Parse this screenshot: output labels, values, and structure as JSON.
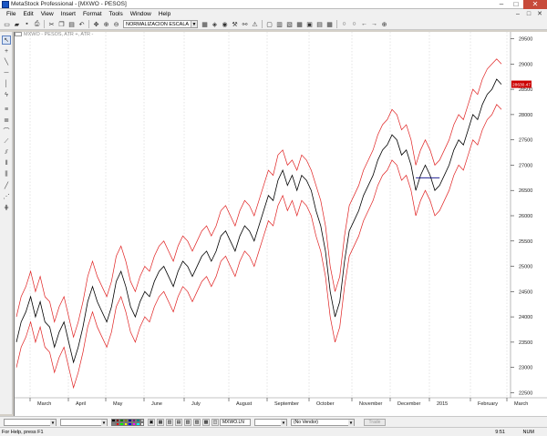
{
  "window": {
    "title": "MetaStock Professional - [MXWO - PESOS]",
    "controls": [
      "–",
      "□",
      "✕"
    ]
  },
  "menu": [
    "File",
    "Edit",
    "View",
    "Insert",
    "Format",
    "Tools",
    "Window",
    "Help"
  ],
  "toolbar": {
    "scale_combo": "NORMALIZACION ESCALA"
  },
  "chart": {
    "header": "MXWO - PESOS, ATR +, ATR -",
    "price_tag": "28630.47",
    "y_ticks": [
      22500,
      23000,
      23500,
      24000,
      24500,
      25000,
      25500,
      26000,
      26500,
      27000,
      27500,
      28000,
      28500,
      29000,
      29500
    ],
    "x_labels": [
      "March",
      "April",
      "May",
      "June",
      "July",
      "August",
      "September",
      "October",
      "November",
      "December",
      "2015",
      "February",
      "March"
    ],
    "colors": {
      "price": "#000000",
      "bands": "#e02020",
      "grid": "#c8c8c8",
      "hline": "#000080",
      "tag_bg": "#cc0000"
    }
  },
  "chart_data": {
    "type": "line",
    "title": "MXWO - PESOS, ATR +, ATR -",
    "xlabel": "",
    "ylabel": "",
    "ylim": [
      22400,
      29600
    ],
    "x_labels": [
      "March",
      "April",
      "May",
      "June",
      "July",
      "August",
      "September",
      "October",
      "November",
      "December",
      "2015",
      "February",
      "March"
    ],
    "series": [
      {
        "name": "MXWO - PESOS",
        "values": [
          23500,
          23900,
          24100,
          24400,
          24000,
          24300,
          23900,
          23800,
          23400,
          23700,
          23900,
          23500,
          23100,
          23400,
          23800,
          24300,
          24600,
          24300,
          24100,
          23900,
          24200,
          24700,
          24900,
          24600,
          24200,
          24000,
          24300,
          24500,
          24400,
          24700,
          24900,
          25000,
          24800,
          24600,
          24900,
          25100,
          25000,
          24800,
          25000,
          25200,
          25300,
          25100,
          25300,
          25600,
          25700,
          25500,
          25300,
          25600,
          25800,
          25700,
          25500,
          25800,
          26100,
          26400,
          26300,
          26700,
          26900,
          26600,
          26800,
          26500,
          26800,
          26700,
          26500,
          26100,
          25800,
          25300,
          24500,
          24000,
          24300,
          25100,
          25700,
          25900,
          26100,
          26400,
          26600,
          26800,
          27100,
          27300,
          27400,
          27600,
          27500,
          27200,
          27300,
          27000,
          26500,
          26800,
          27000,
          26800,
          26500,
          26600,
          26800,
          27000,
          27300,
          27500,
          27400,
          27700,
          28000,
          27900,
          28200,
          28400,
          28500,
          28700,
          28600
        ]
      },
      {
        "name": "ATR +",
        "values": [
          24000,
          24400,
          24600,
          24900,
          24500,
          24800,
          24400,
          24300,
          23900,
          24200,
          24400,
          24000,
          23600,
          23900,
          24300,
          24800,
          25100,
          24800,
          24600,
          24400,
          24700,
          25200,
          25400,
          25100,
          24700,
          24500,
          24800,
          25000,
          24900,
          25200,
          25400,
          25500,
          25300,
          25100,
          25400,
          25600,
          25500,
          25300,
          25500,
          25700,
          25800,
          25600,
          25800,
          26100,
          26200,
          26000,
          25800,
          26100,
          26300,
          26200,
          26000,
          26300,
          26600,
          26900,
          26800,
          27200,
          27300,
          27000,
          27100,
          26900,
          27200,
          27100,
          26900,
          26600,
          26300,
          25800,
          25000,
          24500,
          24800,
          25600,
          26200,
          26400,
          26600,
          26900,
          27100,
          27300,
          27600,
          27800,
          27900,
          28100,
          28000,
          27700,
          27800,
          27500,
          27000,
          27300,
          27500,
          27300,
          27000,
          27100,
          27300,
          27500,
          27800,
          28000,
          27900,
          28200,
          28500,
          28400,
          28700,
          28900,
          29000,
          29100,
          29000
        ]
      },
      {
        "name": "ATR -",
        "values": [
          23000,
          23400,
          23600,
          23900,
          23500,
          23800,
          23400,
          23300,
          22900,
          23200,
          23400,
          23000,
          22600,
          22900,
          23300,
          23800,
          24100,
          23800,
          23600,
          23400,
          23700,
          24200,
          24400,
          24100,
          23700,
          23500,
          23800,
          24000,
          23900,
          24200,
          24400,
          24500,
          24300,
          24100,
          24400,
          24600,
          24500,
          24300,
          24500,
          24700,
          24800,
          24600,
          24800,
          25100,
          25200,
          25000,
          24800,
          25100,
          25300,
          25200,
          25000,
          25300,
          25600,
          25900,
          25800,
          26200,
          26400,
          26100,
          26300,
          26000,
          26300,
          26200,
          26000,
          25600,
          25300,
          24800,
          24000,
          23500,
          23800,
          24600,
          25200,
          25400,
          25600,
          25900,
          26100,
          26300,
          26600,
          26800,
          26900,
          27100,
          27000,
          26700,
          26800,
          26500,
          26000,
          26300,
          26500,
          26300,
          26000,
          26100,
          26300,
          26500,
          26800,
          27000,
          26900,
          27200,
          27500,
          27400,
          27700,
          27900,
          28000,
          28200,
          28100
        ]
      }
    ],
    "hline_value": 26750
  },
  "status": {
    "vendor": "(No Vendor)",
    "symbol": "MXWO.LN",
    "trade": "Trade",
    "help": "For Help, press F1",
    "time": "9:51",
    "num": "NUM"
  }
}
